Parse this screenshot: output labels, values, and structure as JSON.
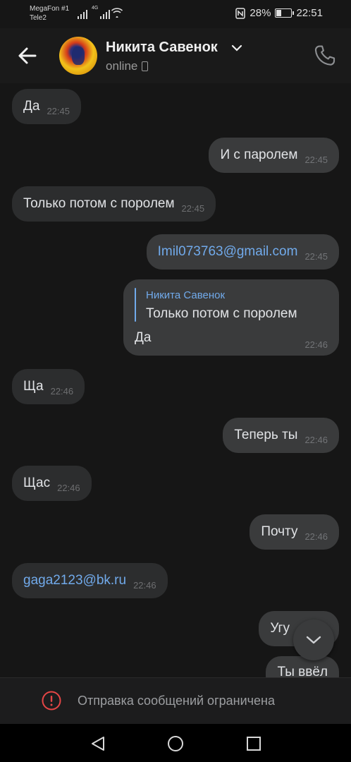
{
  "status_bar": {
    "carrier1": "MegaFon #1",
    "carrier2": "Tele2",
    "battery": "28%",
    "battery_level": 0.28,
    "time": "22:51"
  },
  "header": {
    "name": "Никита Савенок",
    "presence": "online"
  },
  "messages": [
    {
      "dir": "in",
      "text": "Да",
      "time": "22:45"
    },
    {
      "dir": "out",
      "text": "И с паролем",
      "time": "22:45"
    },
    {
      "dir": "in",
      "text": "Только потом с поролем",
      "time": "22:45"
    },
    {
      "dir": "out",
      "text": "Imil073763@gmail.com",
      "time": "22:45",
      "link": true
    },
    {
      "dir": "out",
      "reply_author": "Никита Савенок",
      "reply_text": "Только потом с поролем",
      "text": "Да",
      "time": "22:46"
    },
    {
      "dir": "in",
      "text": "Ща",
      "time": "22:46"
    },
    {
      "dir": "out",
      "text": "Теперь ты",
      "time": "22:46"
    },
    {
      "dir": "in",
      "text": "Щас",
      "time": "22:46"
    },
    {
      "dir": "out",
      "text": "Почту",
      "time": "22:46"
    },
    {
      "dir": "in",
      "text": "gaga2123@bk.ru",
      "time": "22:46",
      "link": true
    },
    {
      "dir": "out",
      "text": "Угу",
      "time": ""
    },
    {
      "dir": "out",
      "text": "Ты ввёл",
      "time": ""
    }
  ],
  "footer": {
    "restriction_text": "Отправка сообщений ограничена"
  },
  "icons": {
    "back": "arrow-left-icon",
    "call": "phone-icon",
    "scroll": "chevron-down-icon",
    "warning": "exclamation-circle-icon",
    "nav": [
      "back-triangle-icon",
      "home-circle-icon",
      "recents-square-icon"
    ]
  },
  "colors": {
    "background": "#161616",
    "bubble_in": "#2c2d2e",
    "bubble_out": "#3a3b3c",
    "link": "#71aaeb",
    "warning": "#e64646"
  }
}
